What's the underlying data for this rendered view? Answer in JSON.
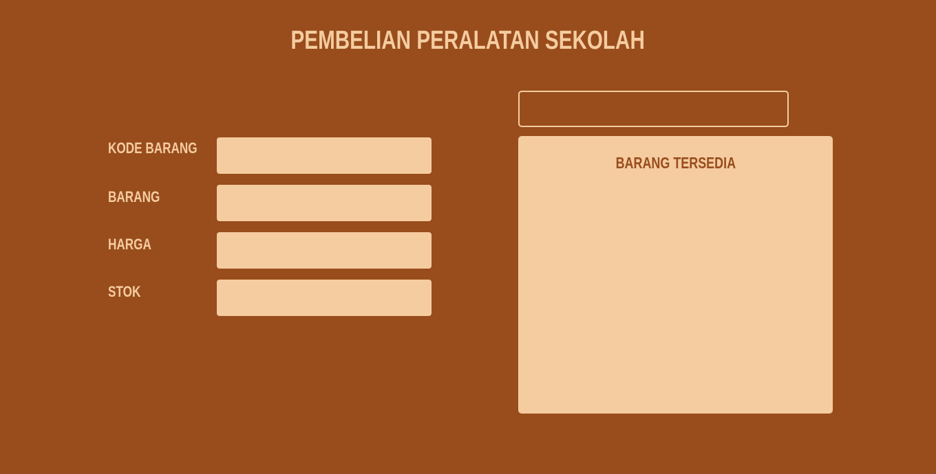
{
  "header": {
    "title": "PEMBELIAN PERALATAN SEKOLAH"
  },
  "form": {
    "fields": [
      {
        "label": "KODE BARANG",
        "value": ""
      },
      {
        "label": "BARANG",
        "value": ""
      },
      {
        "label": "HARGA",
        "value": ""
      },
      {
        "label": "STOK",
        "value": ""
      }
    ]
  },
  "search": {
    "value": ""
  },
  "panel": {
    "title": "BARANG TERSEDIA"
  },
  "colors": {
    "background": "#994d1c",
    "accent": "#f5cca0"
  }
}
